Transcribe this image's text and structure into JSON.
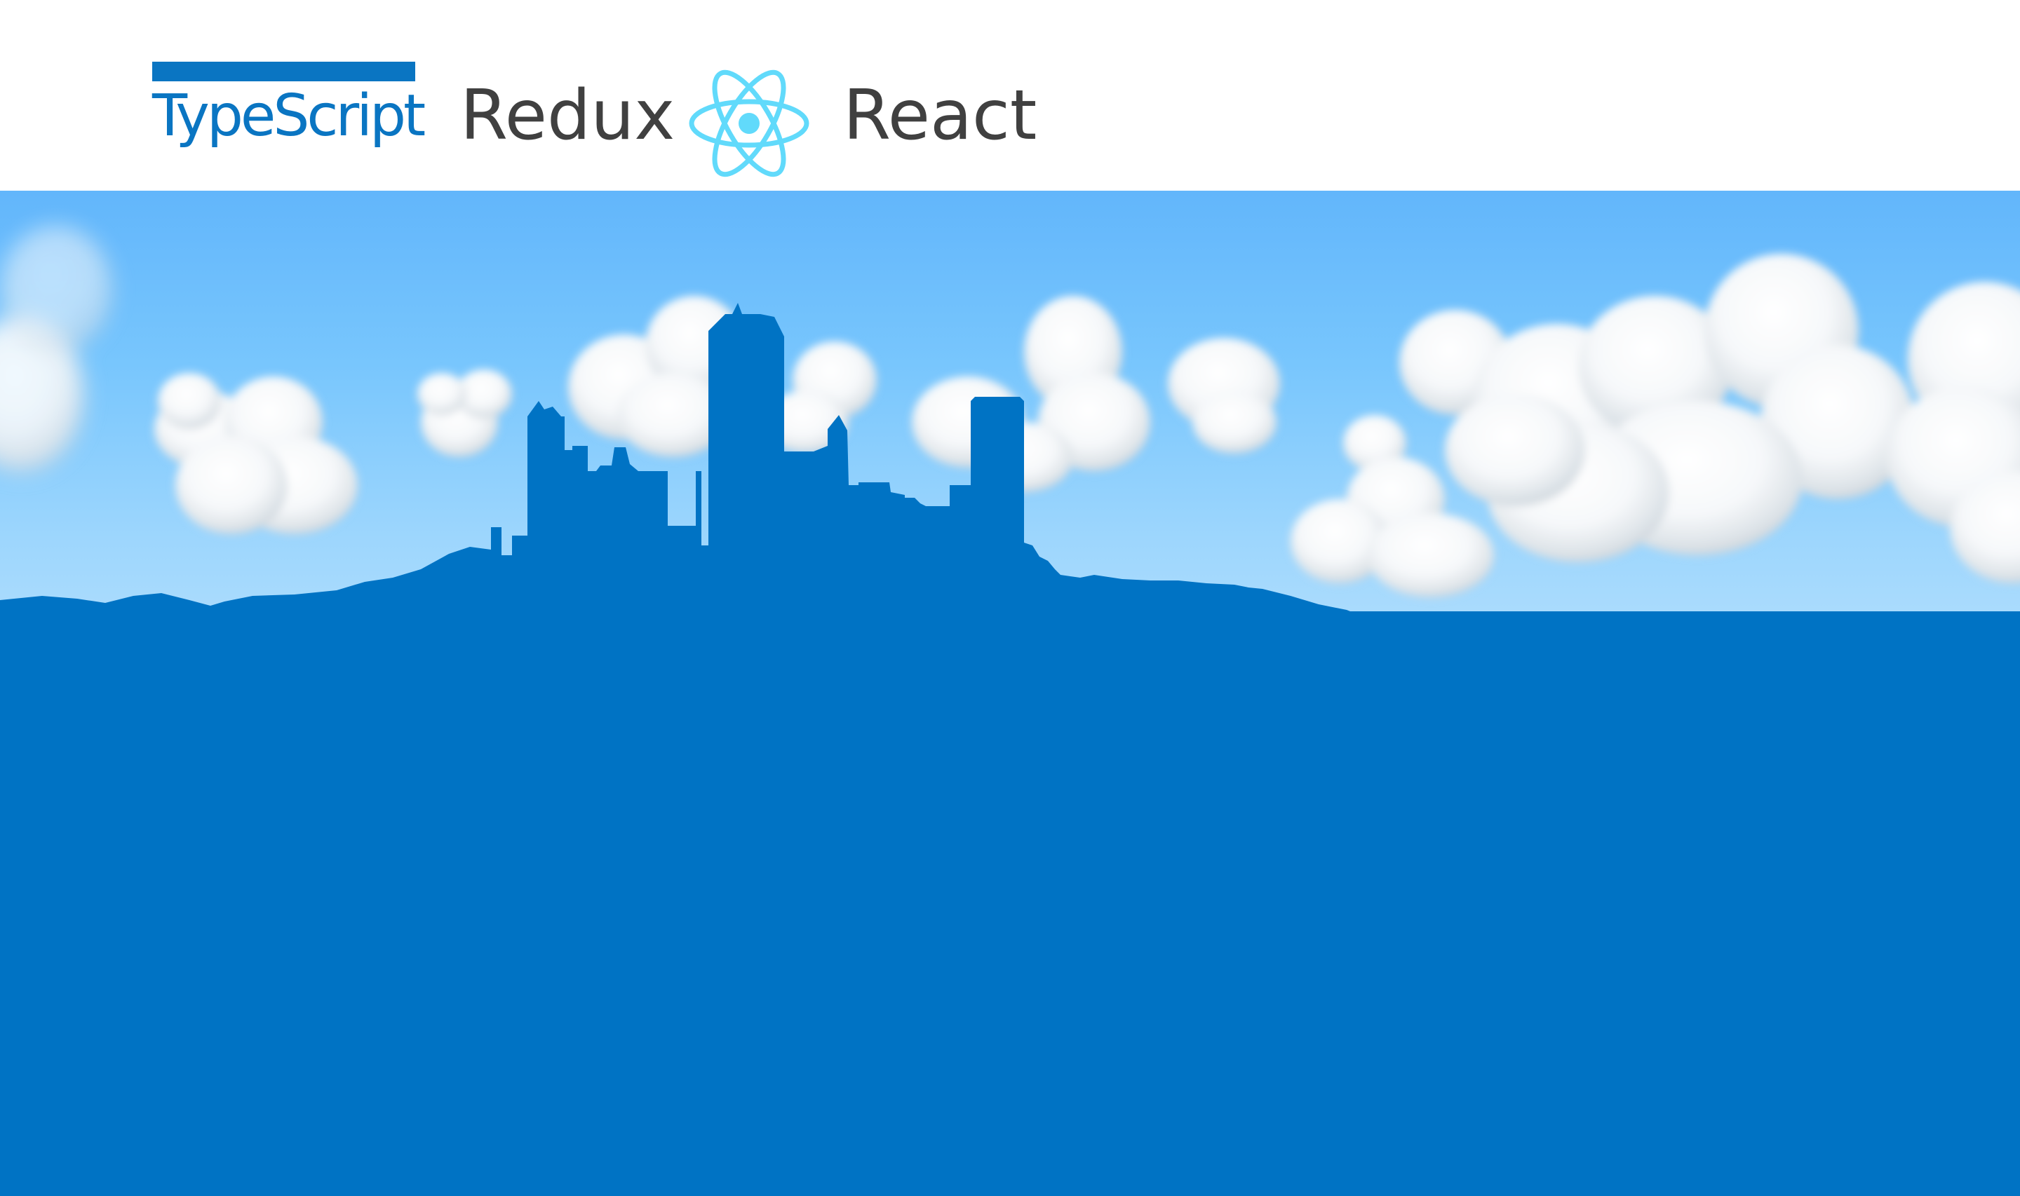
{
  "header": {
    "typescript_logo": "TypeScript",
    "redux_label": "Redux",
    "react_icon": "react-atom-icon",
    "react_label": "React"
  },
  "colors": {
    "typescript_blue": "#0a75c2",
    "text_gray": "#404040",
    "react_cyan": "#61dafb",
    "sky_top": "#62b6fb",
    "sky_bottom": "#acdcfd",
    "skyline_blue": "#0073c4"
  }
}
